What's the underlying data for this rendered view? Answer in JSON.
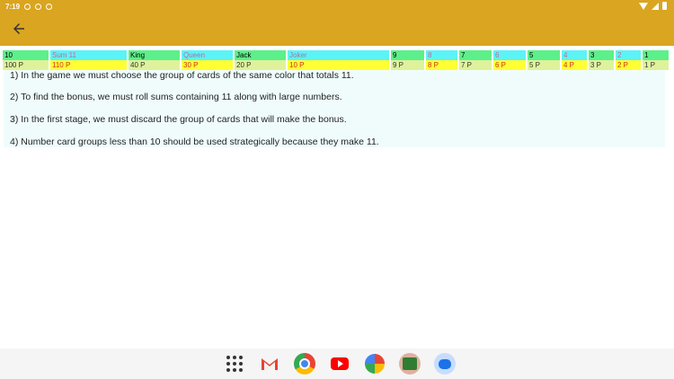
{
  "status_bar": {
    "time": "7:19"
  },
  "table": {
    "headers": [
      {
        "label": "10",
        "style": "green",
        "w": 51
      },
      {
        "label": "Sum 11",
        "style": "cyan",
        "w": 85
      },
      {
        "label": "King",
        "style": "green",
        "w": 57
      },
      {
        "label": "Queen",
        "style": "cyan",
        "w": 57
      },
      {
        "label": "Jack",
        "style": "green",
        "w": 57
      },
      {
        "label": "Joker",
        "style": "cyan",
        "w": 113
      },
      {
        "label": "9",
        "style": "green",
        "w": 37
      },
      {
        "label": "8",
        "style": "cyan",
        "w": 35
      },
      {
        "label": "7",
        "style": "green",
        "w": 36
      },
      {
        "label": "6",
        "style": "cyan",
        "w": 36
      },
      {
        "label": "5",
        "style": "green",
        "w": 36
      },
      {
        "label": "4",
        "style": "cyan",
        "w": 28
      },
      {
        "label": "3",
        "style": "green",
        "w": 28
      },
      {
        "label": "2",
        "style": "cyan",
        "w": 28
      },
      {
        "label": "1",
        "style": "green",
        "w": 29
      }
    ],
    "points": [
      {
        "label": "100 P",
        "style": "plain"
      },
      {
        "label": "110 P",
        "style": "yellow"
      },
      {
        "label": "40 P",
        "style": "plain"
      },
      {
        "label": "30 P",
        "style": "yellow"
      },
      {
        "label": "20 P",
        "style": "plain"
      },
      {
        "label": "10 P",
        "style": "yellow"
      },
      {
        "label": "9 P",
        "style": "plain"
      },
      {
        "label": "8 P",
        "style": "yellow"
      },
      {
        "label": "7 P",
        "style": "plain"
      },
      {
        "label": "6 P",
        "style": "yellow"
      },
      {
        "label": "5 P",
        "style": "plain"
      },
      {
        "label": "4 P",
        "style": "yellow"
      },
      {
        "label": "3 P",
        "style": "plain"
      },
      {
        "label": "2 P",
        "style": "yellow"
      },
      {
        "label": "1 P",
        "style": "plain"
      }
    ]
  },
  "rules": [
    "1) In the game we must choose the group of cards of the same color that totals 11.",
    "2) To find the bonus, we must roll sums containing 11 along with large numbers.",
    "3) In the first stage, we must discard the group of cards that will make the bonus.",
    "4) Number card groups less than 10 should be used strategically because they make 11."
  ],
  "dock": [
    "apps-grid-icon",
    "gmail-icon",
    "chrome-icon",
    "youtube-icon",
    "photos-icon",
    "app-11-icon",
    "messages-icon"
  ],
  "colors": {
    "appbar": "#daa520",
    "green": "#5cf08a",
    "cyan": "#5cf3f7",
    "yellow": "#ffff33"
  }
}
